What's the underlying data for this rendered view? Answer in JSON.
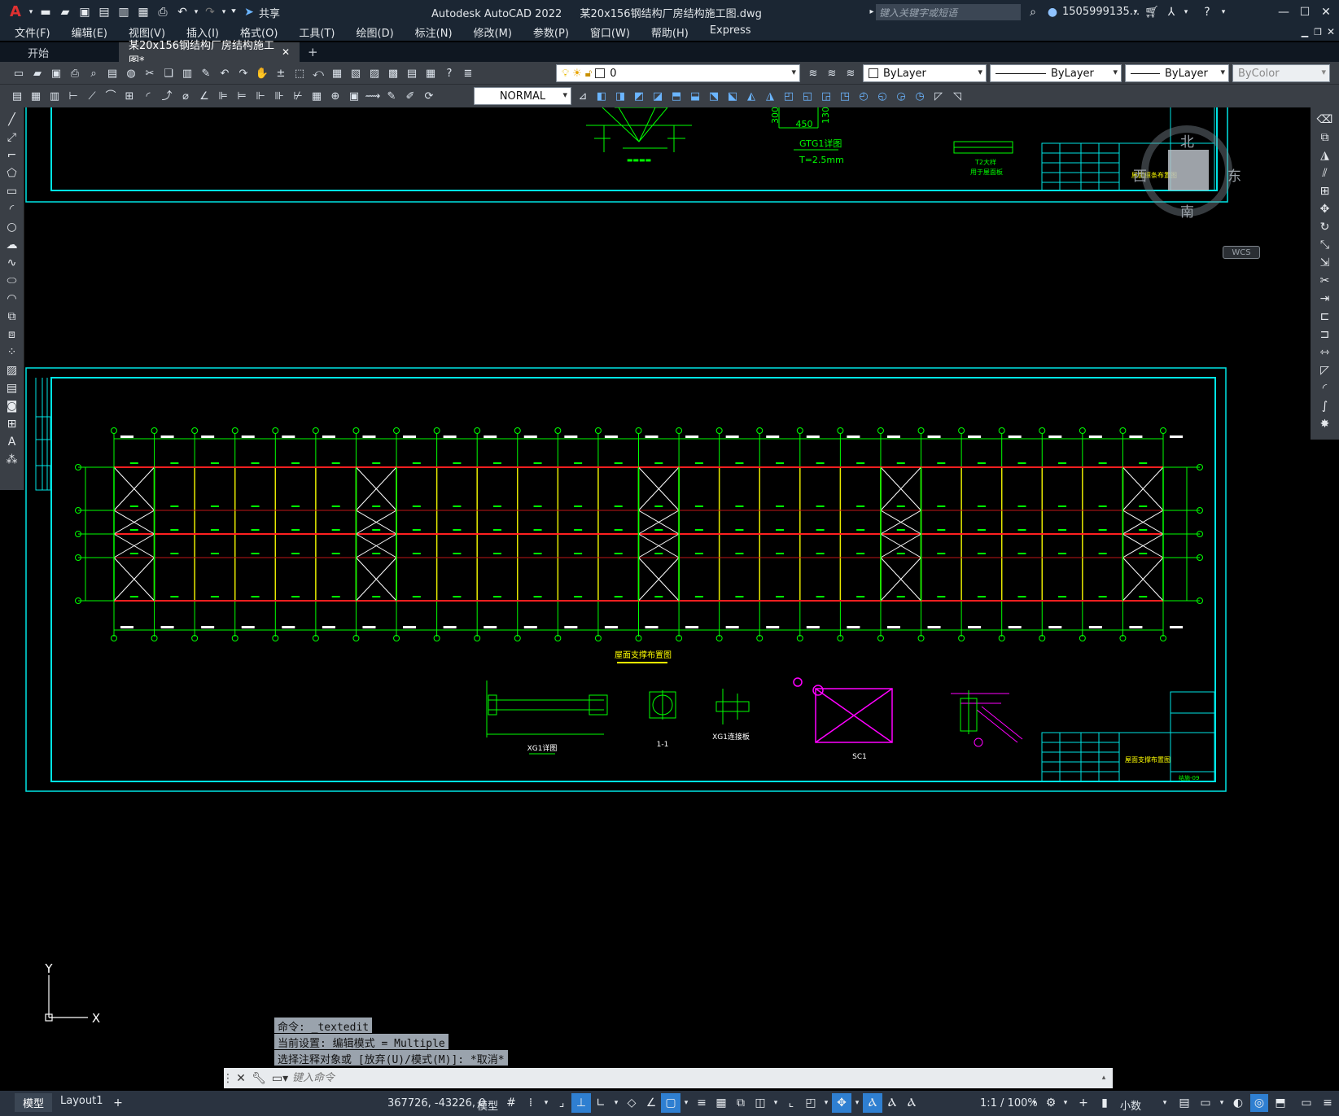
{
  "app": {
    "title": "Autodesk AutoCAD 2022",
    "file_name": "某20x156钢结构厂房结构施工图.dwg",
    "share_label": "共享",
    "search_placeholder": "键入关键字或短语",
    "user": "1505999135...",
    "window_buttons": [
      "—",
      "☐",
      "✕"
    ]
  },
  "menu": [
    "文件(F)",
    "编辑(E)",
    "视图(V)",
    "插入(I)",
    "格式(O)",
    "工具(T)",
    "绘图(D)",
    "标注(N)",
    "修改(M)",
    "参数(P)",
    "窗口(W)",
    "帮助(H)",
    "Express"
  ],
  "tabs": [
    {
      "label": "开始"
    },
    {
      "label": "某20x156钢结构厂房结构施工图*"
    }
  ],
  "layer": {
    "current": "0"
  },
  "properties": {
    "color": "ByLayer",
    "linetype": "ByLayer",
    "lineweight": "ByLayer",
    "plotstyle": "ByColor"
  },
  "text_style": "NORMAL",
  "viewcube": {
    "north": "北",
    "south": "南",
    "east": "东",
    "west": "西",
    "wcs": "WCS"
  },
  "drawing": {
    "upper_labels": {
      "gtg": "GTG1详图",
      "thickness": "T=2.5mm",
      "dim450": "450",
      "dim300": "300",
      "dim130": "130",
      "detail1": "T2大样",
      "detail2": "用于屋面板"
    },
    "plan_title": "屋面支撑布置图",
    "detail_labels": [
      "XG1详图",
      "1-1",
      "XG1连接板",
      "SC1"
    ],
    "sheet_title_upper": "屋面檩条布置图",
    "sheet_title_lower": "屋面支撑布置图",
    "titleblock_code": "结施-09"
  },
  "command_history": [
    "命令: _textedit",
    "当前设置: 编辑模式 = Multiple",
    "选择注释对象或 [放弃(U)/模式(M)]: *取消*"
  ],
  "command_placeholder": "键入命令",
  "status": {
    "model_tabs": [
      "模型",
      "Layout1"
    ],
    "coords": "367726, -43226, 0",
    "mode": "模型",
    "scale": "1:1 / 100%",
    "units": "小数"
  },
  "colors": {
    "cyan": "#00e5e5",
    "green": "#00ff00",
    "red": "#ff2020",
    "magenta": "#ff00ff",
    "white": "#ffffff",
    "yellow": "#e8e800"
  }
}
